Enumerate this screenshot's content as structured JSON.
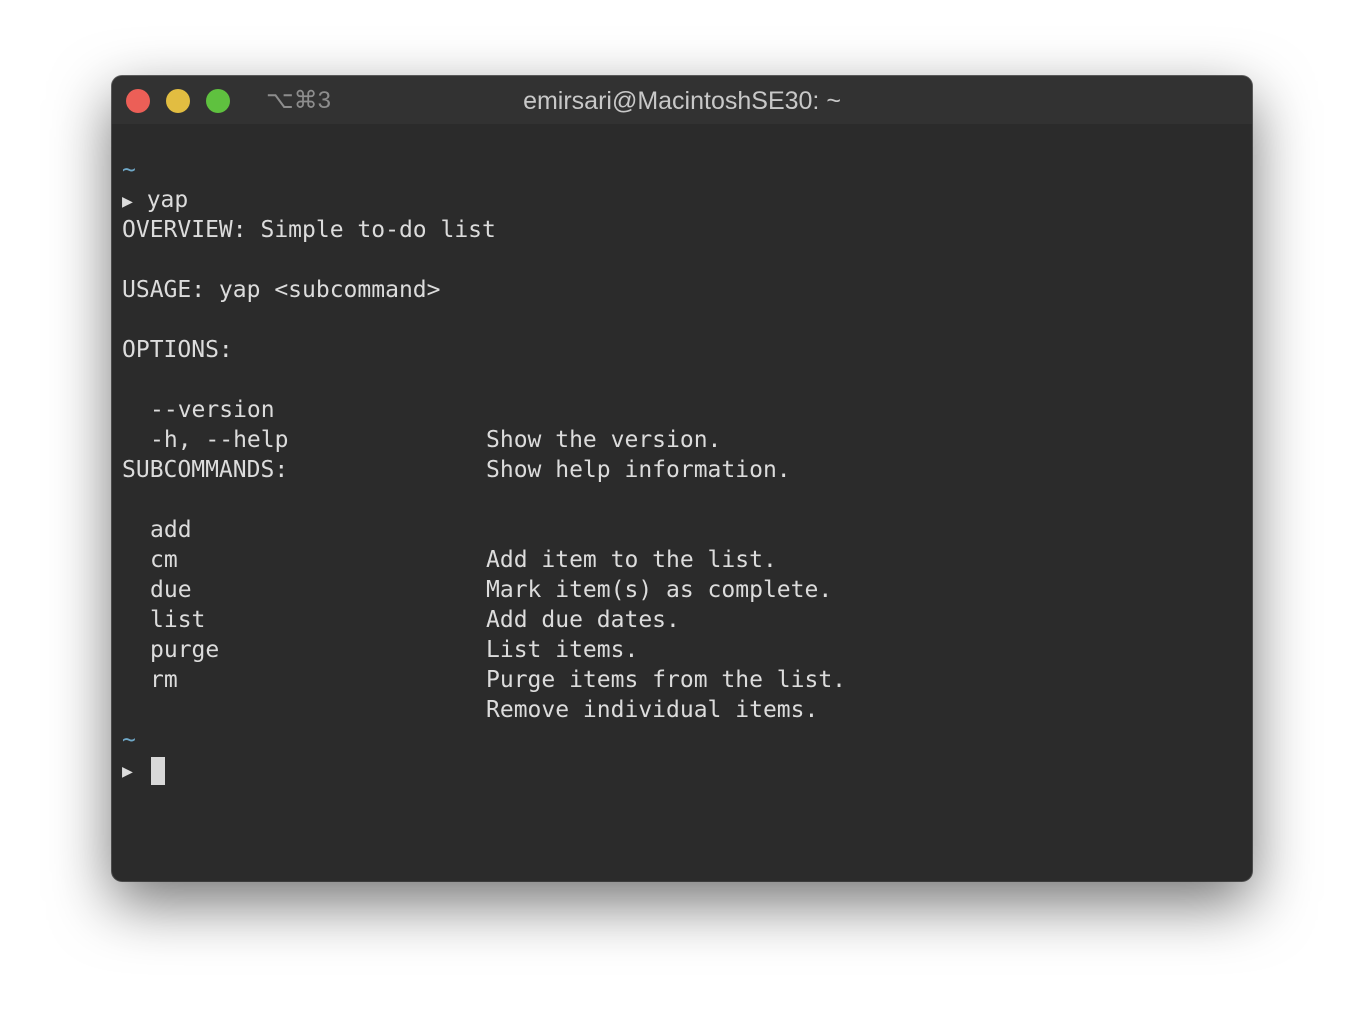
{
  "window": {
    "title": "emirsari@MacintoshSE30: ~",
    "shortcut": "⌥⌘3"
  },
  "terminal": {
    "prompt_dir": "~",
    "prompt_arrow": "▶",
    "command": "yap",
    "overview": "OVERVIEW: Simple to-do list",
    "usage": "USAGE: yap <subcommand>",
    "options_header": "OPTIONS:",
    "options": [
      {
        "name": "--version",
        "desc": "Show the version."
      },
      {
        "name": "-h, --help",
        "desc": "Show help information."
      }
    ],
    "subcommands_header": "SUBCOMMANDS:",
    "subcommands": [
      {
        "name": "add",
        "desc": "Add item to the list."
      },
      {
        "name": "cm",
        "desc": "Mark item(s) as complete."
      },
      {
        "name": "due",
        "desc": "Add due dates."
      },
      {
        "name": "list",
        "desc": "List items."
      },
      {
        "name": "purge",
        "desc": "Purge items from the list."
      },
      {
        "name": "rm",
        "desc": "Remove individual items."
      }
    ]
  },
  "colors": {
    "background": "#2b2b2b",
    "titlebar": "#323232",
    "text": "#dcdcdc",
    "prompt_dir": "#6fa8c8",
    "close": "#ec5f57",
    "minimize": "#e2bd41",
    "maximize": "#5fc13f"
  }
}
